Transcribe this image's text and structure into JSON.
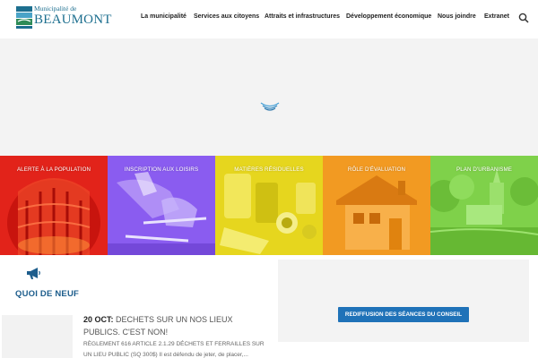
{
  "header": {
    "logo_top": "Municipalité de",
    "logo_main": "BEAUMONT",
    "nav": [
      {
        "label": "La municipalité"
      },
      {
        "label": "Services aux citoyens"
      },
      {
        "label": "Attraits et infrastructures"
      },
      {
        "label": "Développement économique"
      },
      {
        "label": "Nous joindre"
      },
      {
        "label": "Extranet"
      }
    ]
  },
  "tiles": [
    {
      "label": "ALERTE À LA POPULATION",
      "color": "#e2231a"
    },
    {
      "label": "INSCRIPTION AUX LOISIRS",
      "color": "#8a5cf0"
    },
    {
      "label": "MATIÈRES RÉSIDUELLES",
      "color": "#e6d61e"
    },
    {
      "label": "RÔLE D'ÉVALUATION",
      "color": "#f29a22"
    },
    {
      "label": "PLAN D'URBANISME",
      "color": "#7fd14a"
    }
  ],
  "news": {
    "section_title": "QUOI DE NEUF",
    "date": "20 OCT:",
    "headline": "DECHETS SUR UN NOS LIEUX PUBLICS. C'EST NON!",
    "excerpt": "RÈGLEMENT 616 ARTICLE 2.1.29 DÉCHETS ET FERRAILLES SUR UN LIEU PUBLIC (SQ 300$) Il est défendu de jeter, de placer,..."
  },
  "right_panel": {
    "button_label": "REDIFFUSION DES SÉANCES DU CONSEIL"
  }
}
